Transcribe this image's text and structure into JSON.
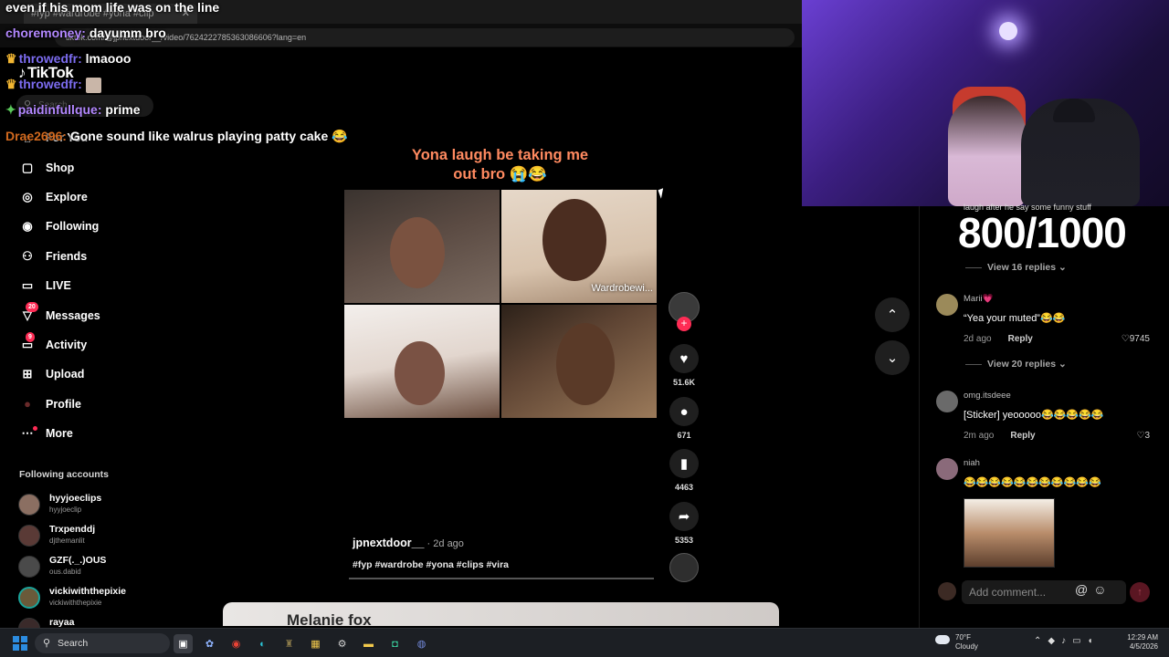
{
  "browser": {
    "tab_title": "#fyp #wardrobe #yona #clip",
    "url": "tiktok.com/@jpnextdoor__/video/7624222785363086606?lang=en"
  },
  "tiktok": {
    "logo": "TikTok",
    "search_placeholder": "Search",
    "nav": [
      {
        "label": "For You"
      },
      {
        "label": "Shop"
      },
      {
        "label": "Explore"
      },
      {
        "label": "Following"
      },
      {
        "label": "Friends"
      },
      {
        "label": "LIVE"
      },
      {
        "label": "Messages",
        "badge": "20"
      },
      {
        "label": "Activity",
        "badge": "9"
      },
      {
        "label": "Upload"
      },
      {
        "label": "Profile"
      },
      {
        "label": "More"
      }
    ],
    "following_title": "Following accounts",
    "following": [
      {
        "name": "hyyjoeclips",
        "handle": "hyyjoeclip"
      },
      {
        "name": "Trxpenddj",
        "handle": "djthemanlit"
      },
      {
        "name": "GZF(._.)OUS",
        "handle": "ous.dabid"
      },
      {
        "name": "vickiwiththepixie",
        "handle": "vickiwiththepixie"
      },
      {
        "name": "rayaa",
        "handle": ""
      }
    ]
  },
  "chat": [
    {
      "user": "",
      "user_color": "#ffffff",
      "text": "even if his mom life was on the line"
    },
    {
      "user": "choremoney:",
      "user_color": "#b388ff",
      "text": "dayumm bro"
    },
    {
      "user": "throwedfr:",
      "user_color": "#7c6cf0",
      "text": "lmaooo",
      "badge": "crown"
    },
    {
      "user": "throwedfr:",
      "user_color": "#7c6cf0",
      "text": "",
      "badge": "crown",
      "emote": true
    },
    {
      "user": "paidinfullque:",
      "user_color": "#b388ff",
      "text": "prime",
      "badge": "gem"
    },
    {
      "user": "Drae2696:",
      "user_color": "#d2691e",
      "text": "Gone sound like walrus playing patty cake 😂"
    }
  ],
  "video": {
    "caption_line1": "Yona laugh be taking me",
    "caption_line2": "out bro 😭😂",
    "watermark": "Wardrobewi...",
    "author": "jpnextdoor__",
    "ago": " · 2d ago",
    "tags": "#fyp #wardrobe #yona #clips #vira",
    "likes": "51.6K",
    "comments": "671",
    "saves": "4463",
    "shares": "5353",
    "next_card_text": "Melanie fox"
  },
  "comments": {
    "partial_text": "laugh after he say some funny stuff",
    "score": "800/1000",
    "view_replies_1": "View 16 replies",
    "view_replies_2": "View 20 replies",
    "items": [
      {
        "user": "Marii💗",
        "text": "“Yea your muted”😂😂",
        "ago": "2d ago",
        "reply": "Reply",
        "likes": "9745"
      },
      {
        "user": "omg.itsdeee",
        "text": "[Sticker] yeooooo😂😂😂😂😂",
        "ago": "2m ago",
        "reply": "Reply",
        "likes": "3"
      },
      {
        "user": "niah",
        "text": "😂😂😂😂😂😂😂😂😂😂😂",
        "ago": "",
        "reply": "",
        "likes": ""
      }
    ],
    "add_comment_placeholder": "Add comment..."
  },
  "taskbar": {
    "search": "Search",
    "weather_temp": "70°F",
    "weather_desc": "Cloudy",
    "time": "12:29 AM",
    "date": "4/5/2026"
  }
}
